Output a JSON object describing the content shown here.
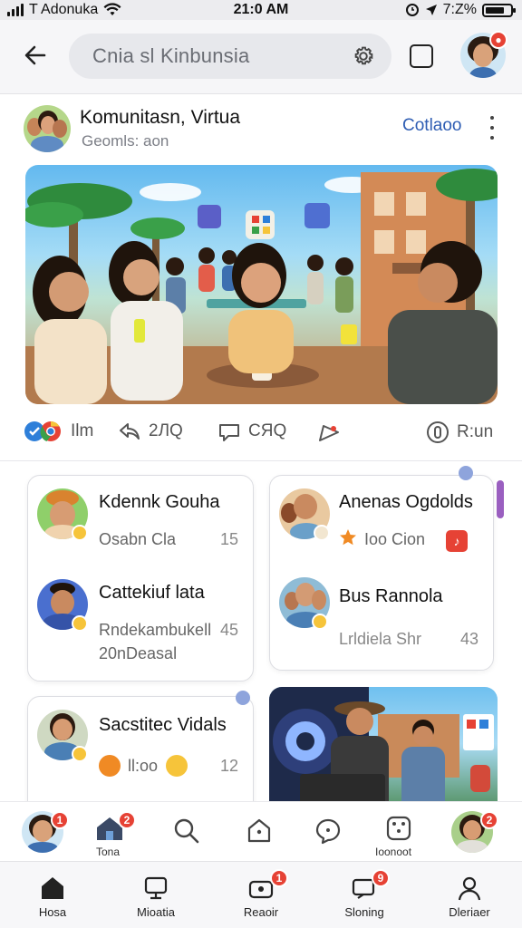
{
  "status_bar": {
    "carrier": "T Adonuka",
    "time": "21:0 AM",
    "battery": "7:Z%"
  },
  "header": {
    "search_text": "Cnia sl Kinbunsia"
  },
  "post": {
    "title": "Komunitasn, Virtua",
    "subtitle": "Geomls: aon",
    "follow_label": "Cotlaoo"
  },
  "actions": {
    "like_count": "Ilm",
    "share_count": "2ЛQ",
    "comment_count": "CЯQ",
    "save_label": "R:un"
  },
  "cards": {
    "left_top": {
      "rows": [
        {
          "name": "Kdennk Gouha",
          "sub": "Osabn Cla",
          "count": "15"
        },
        {
          "name": "Cattekiuf lata",
          "sub": "Rndekambukell",
          "sub2": "20nDeasal",
          "count": "45"
        }
      ]
    },
    "right_top": {
      "rows": [
        {
          "name": "Anenas Ogdolds",
          "sub": "Ioo Cion",
          "count": ""
        },
        {
          "name": "Bus Rannola",
          "sub": "Lrldiela Shr",
          "count": "43"
        }
      ]
    },
    "left_bottom": {
      "rows": [
        {
          "name": "Sacstitec Vidals",
          "sub": "ll:oo",
          "count": "12"
        }
      ]
    }
  },
  "stories": {
    "items": [
      {
        "label": "",
        "badge": "1"
      },
      {
        "label": "Tona",
        "badge": "2"
      },
      {
        "label": "",
        "badge": ""
      },
      {
        "label": "",
        "badge": ""
      },
      {
        "label": "",
        "badge": ""
      },
      {
        "label": "Ioonoot",
        "badge": ""
      },
      {
        "label": "",
        "badge": "2"
      }
    ]
  },
  "bottom_nav": {
    "items": [
      {
        "label": "Hosa",
        "badge": ""
      },
      {
        "label": "Mioatia",
        "badge": ""
      },
      {
        "label": "Reaoir",
        "badge": "1"
      },
      {
        "label": "Sloning",
        "badge": "9"
      },
      {
        "label": "Dleriaer",
        "badge": ""
      }
    ]
  },
  "colors": {
    "accent_link": "#2e5db3",
    "badge_red": "#e64235",
    "emoji_yellow": "#f6c43a",
    "status_bar_bg": "#ececef"
  }
}
